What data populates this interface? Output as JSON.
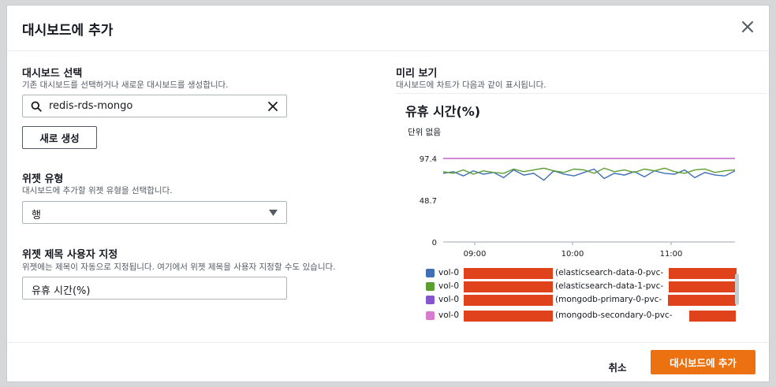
{
  "dialog": {
    "title": "대시보드에 추가"
  },
  "dashboard_select": {
    "label": "대시보드 선택",
    "description": "기존 대시보드를 선택하거나 새로운 대시보드를 생성합니다.",
    "search_value": "redis-rds-mongo",
    "new_button": "새로 생성"
  },
  "widget_type": {
    "label": "위젯 유형",
    "description": "대시보드에 추가할 위젯 유형을 선택합니다.",
    "selected": "행"
  },
  "widget_title": {
    "label": "위젯 제목 사용자 지정",
    "description": "위젯에는 제목이 자동으로 지정됩니다. 여기에서 위젯 제목을 사용자 지정할 수도 있습니다.",
    "value": "유휴 시간(%)"
  },
  "preview": {
    "label": "미리 보기",
    "description": "대시보드에 차트가 다음과 같이 표시됩니다."
  },
  "chart_data": {
    "type": "line",
    "title": "유휴 시간(%)",
    "ylabel": "단위 없음",
    "ylim": [
      0,
      97.4
    ],
    "yticks": [
      "97.4",
      "48.7",
      "0"
    ],
    "xticks": [
      "09:00",
      "10:00",
      "11:00"
    ],
    "grid": false,
    "legend_position": "bottom",
    "series": [
      {
        "name": "vol-0 (elasticsearch-data-0-pvc-",
        "color": "#3f6fb5",
        "values": [
          80,
          82,
          77,
          83,
          79,
          81,
          75,
          84,
          78,
          80,
          72,
          83,
          79,
          77,
          81,
          85,
          74,
          80,
          78,
          82,
          76,
          83,
          80,
          79,
          84,
          75,
          81,
          78,
          77,
          83
        ]
      },
      {
        "name": "vol-0 (elasticsearch-data-1-pvc-",
        "color": "#5a9e2f",
        "values": [
          82,
          80,
          84,
          79,
          83,
          81,
          80,
          85,
          82,
          84,
          86,
          83,
          81,
          85,
          84,
          80,
          86,
          82,
          84,
          81,
          85,
          83,
          86,
          82,
          80,
          84,
          85,
          81,
          83,
          84
        ]
      },
      {
        "name": "vol-0 (mongodb-primary-0-pvc-",
        "color": "#8456ce",
        "values": [
          97.4,
          97.4,
          97.4,
          97.4,
          97.4,
          97.4,
          97.4,
          97.4,
          97.4,
          97.4,
          97.4,
          97.4,
          97.4,
          97.4,
          97.4,
          97.4,
          97.4,
          97.4,
          97.4,
          97.4,
          97.4,
          97.4,
          97.4,
          97.4,
          97.4,
          97.4,
          97.4,
          97.4,
          97.4,
          97.4
        ]
      },
      {
        "name": "vol-0 (mongodb-secondary-0-pvc-",
        "color": "#d77bcf",
        "values": [
          97.2,
          97.2,
          97.2,
          97.2,
          97.2,
          97.2,
          97.2,
          97.2,
          97.2,
          97.2,
          97.2,
          97.2,
          97.2,
          97.2,
          97.2,
          97.2,
          97.2,
          97.2,
          97.2,
          97.2,
          97.2,
          97.2,
          97.2,
          97.2,
          97.2,
          97.2,
          97.2,
          97.2,
          97.2,
          97.2
        ]
      }
    ]
  },
  "legend": [
    {
      "prefix": "vol-0",
      "suffix": "(elasticsearch-data-0-pvc-",
      "color": "#3f6fb5"
    },
    {
      "prefix": "vol-0",
      "suffix": "(elasticsearch-data-1-pvc-",
      "color": "#5a9e2f"
    },
    {
      "prefix": "vol-0",
      "suffix": "(mongodb-primary-0-pvc-",
      "color": "#8456ce"
    },
    {
      "prefix": "vol-0",
      "suffix": "(mongodb-secondary-0-pvc-",
      "color": "#d77bcf"
    }
  ],
  "footer": {
    "cancel": "취소",
    "add": "대시보드에 추가"
  },
  "colors": {
    "accent": "#ec7211",
    "redaction": "#e0421b"
  }
}
